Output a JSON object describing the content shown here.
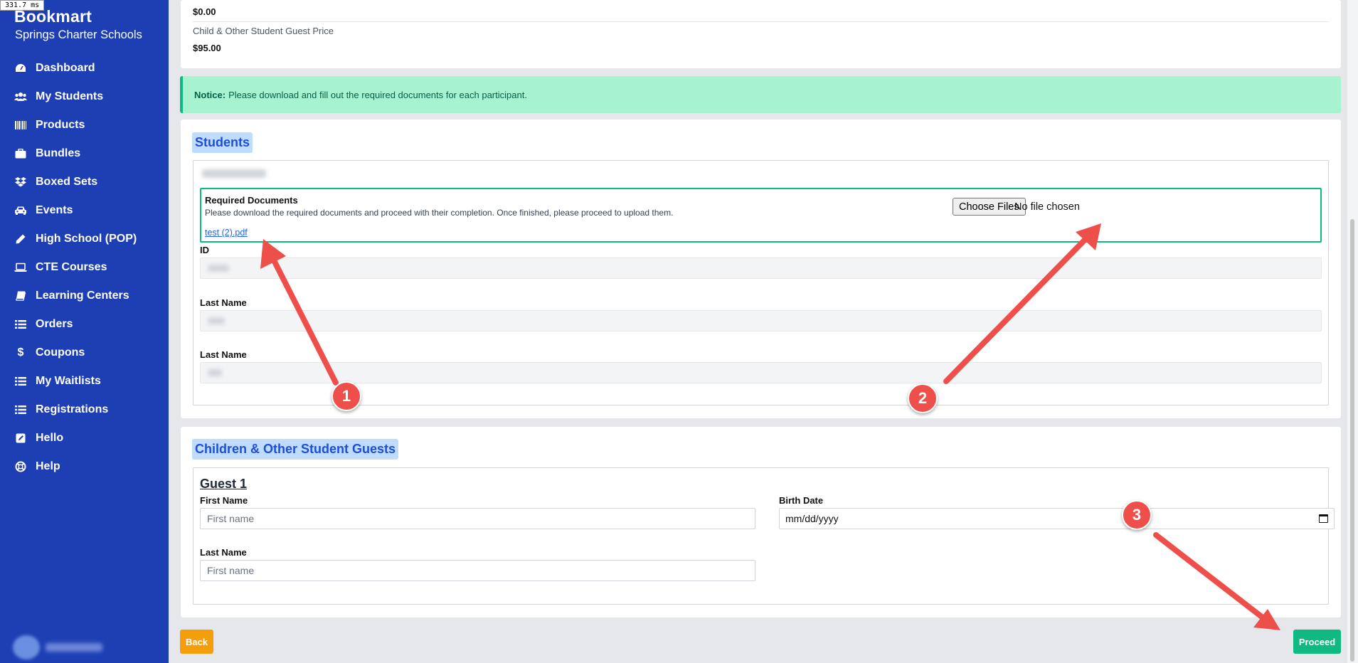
{
  "timer": "331.7 ms",
  "sidebar": {
    "brand": "Bookmart",
    "subtitle": "Springs Charter Schools",
    "items": [
      {
        "label": "Dashboard",
        "icon": "dashboard-icon"
      },
      {
        "label": "My Students",
        "icon": "users-icon"
      },
      {
        "label": "Products",
        "icon": "barcode-icon"
      },
      {
        "label": "Bundles",
        "icon": "briefcase-icon"
      },
      {
        "label": "Boxed Sets",
        "icon": "dropbox-icon"
      },
      {
        "label": "Events",
        "icon": "car-icon"
      },
      {
        "label": "High School (POP)",
        "icon": "pencil-icon"
      },
      {
        "label": "CTE Courses",
        "icon": "laptop-icon"
      },
      {
        "label": "Learning Centers",
        "icon": "book-icon"
      },
      {
        "label": "Orders",
        "icon": "list-icon"
      },
      {
        "label": "Coupons",
        "icon": "dollar-icon"
      },
      {
        "label": "My Waitlists",
        "icon": "list-icon"
      },
      {
        "label": "Registrations",
        "icon": "list-icon"
      },
      {
        "label": "Hello",
        "icon": "edit-square-icon"
      },
      {
        "label": "Help",
        "icon": "lifebuoy-icon"
      }
    ]
  },
  "pricing": {
    "top_value": "$0.00",
    "guest_label": "Child & Other Student Guest Price",
    "guest_value": "$95.00"
  },
  "notice": {
    "prefix": "Notice:",
    "text": "Please download and fill out the required documents for each participant."
  },
  "students": {
    "title": "Students",
    "docs": {
      "title": "Required Documents",
      "description": "Please download the required documents and proceed with their completion. Once finished, please proceed to upload them.",
      "link": "test (2).pdf",
      "choose_button": "Choose Files",
      "file_status": "No file chosen"
    },
    "fields": [
      {
        "label": "ID"
      },
      {
        "label": "Last Name"
      },
      {
        "label": "Last Name"
      }
    ]
  },
  "guests": {
    "title": "Children & Other Student Guests",
    "guest_heading": "Guest 1",
    "first_name_label": "First Name",
    "first_name_placeholder": "First name",
    "birth_date_label": "Birth Date",
    "birth_date_placeholder": "mm/dd/yyyy",
    "last_name_label": "Last Name",
    "last_name_placeholder": "First name"
  },
  "buttons": {
    "back": "Back",
    "proceed": "Proceed"
  },
  "annotations": [
    "1",
    "2",
    "3"
  ],
  "colors": {
    "sidebar": "#1e3fb4",
    "notice_bg": "#a7f3d0",
    "accent_green": "#10b981",
    "back_orange": "#f59e0b",
    "annotation_red": "#ef4f4a"
  }
}
